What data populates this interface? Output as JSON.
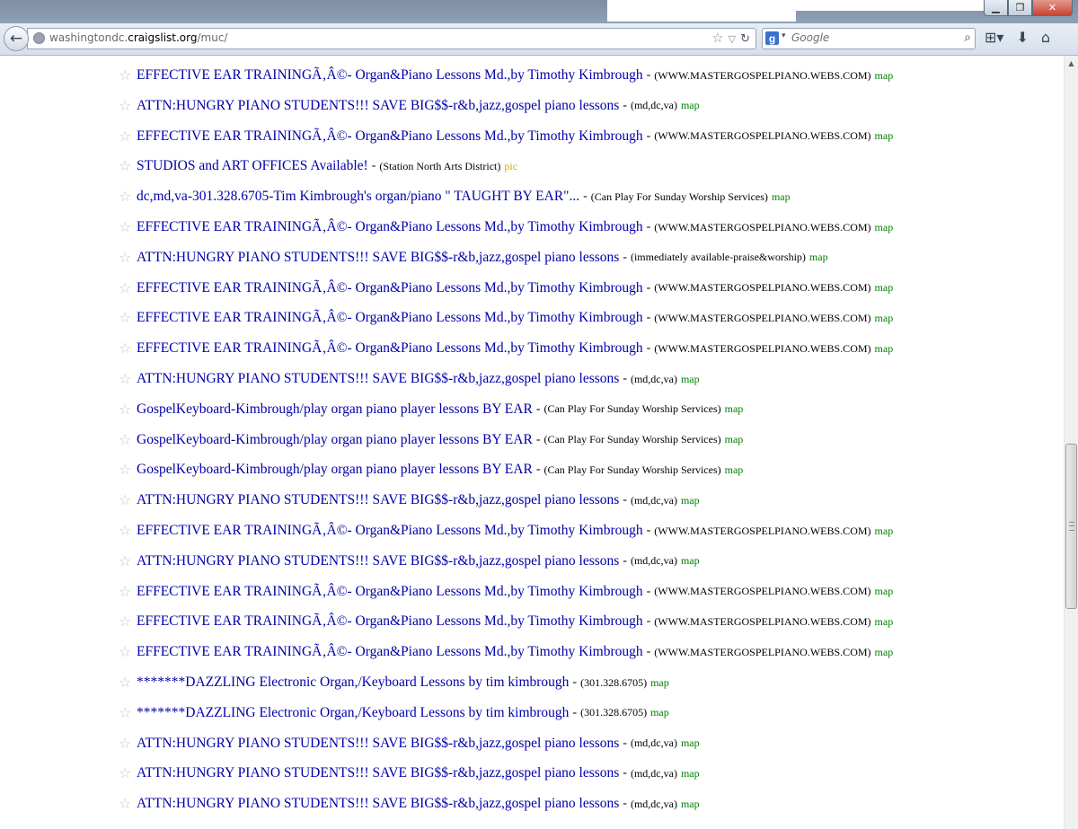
{
  "browser": {
    "url_prefix": "washingtondc.",
    "url_domain": "craigslist.org",
    "url_path": "/muc/",
    "search_placeholder": "Google",
    "search_engine_letter": "g"
  },
  "listings": [
    {
      "title": "EFFECTIVE EAR TRAININGÃ‚Â©- Organ&Piano Lessons Md.,by Timothy Kimbrough",
      "location": "(WWW.MASTERGOSPELPIANO.WEBS.COM)",
      "tag": "map"
    },
    {
      "title": "ATTN:HUNGRY PIANO STUDENTS!!! SAVE BIG$$-r&b,jazz,gospel piano lessons",
      "location": "(md,dc,va)",
      "tag": "map"
    },
    {
      "title": "EFFECTIVE EAR TRAININGÃ‚Â©- Organ&Piano Lessons Md.,by Timothy Kimbrough",
      "location": "(WWW.MASTERGOSPELPIANO.WEBS.COM)",
      "tag": "map"
    },
    {
      "title": "STUDIOS and ART OFFICES Available!",
      "location": "(Station North Arts District)",
      "tag": "pic"
    },
    {
      "title": "dc,md,va-301.328.6705-Tim Kimbrough's organ/piano \" TAUGHT BY EAR\"...",
      "location": "(Can Play For Sunday Worship Services)",
      "tag": "map"
    },
    {
      "title": "EFFECTIVE EAR TRAININGÃ‚Â©- Organ&Piano Lessons Md.,by Timothy Kimbrough",
      "location": "(WWW.MASTERGOSPELPIANO.WEBS.COM)",
      "tag": "map"
    },
    {
      "title": "ATTN:HUNGRY PIANO STUDENTS!!! SAVE BIG$$-r&b,jazz,gospel piano lessons",
      "location": "(immediately available-praise&worship)",
      "tag": "map"
    },
    {
      "title": "EFFECTIVE EAR TRAININGÃ‚Â©- Organ&Piano Lessons Md.,by Timothy Kimbrough",
      "location": "(WWW.MASTERGOSPELPIANO.WEBS.COM)",
      "tag": "map"
    },
    {
      "title": "EFFECTIVE EAR TRAININGÃ‚Â©- Organ&Piano Lessons Md.,by Timothy Kimbrough",
      "location": "(WWW.MASTERGOSPELPIANO.WEBS.COM)",
      "tag": "map"
    },
    {
      "title": "EFFECTIVE EAR TRAININGÃ‚Â©- Organ&Piano Lessons Md.,by Timothy Kimbrough",
      "location": "(WWW.MASTERGOSPELPIANO.WEBS.COM)",
      "tag": "map"
    },
    {
      "title": "ATTN:HUNGRY PIANO STUDENTS!!! SAVE BIG$$-r&b,jazz,gospel piano lessons",
      "location": "(md,dc,va)",
      "tag": "map"
    },
    {
      "title": "GospelKeyboard-Kimbrough/play organ piano player lessons BY EAR",
      "location": "(Can Play For Sunday Worship Services)",
      "tag": "map"
    },
    {
      "title": "GospelKeyboard-Kimbrough/play organ piano player lessons BY EAR",
      "location": "(Can Play For Sunday Worship Services)",
      "tag": "map"
    },
    {
      "title": "GospelKeyboard-Kimbrough/play organ piano player lessons BY EAR",
      "location": "(Can Play For Sunday Worship Services)",
      "tag": "map"
    },
    {
      "title": "ATTN:HUNGRY PIANO STUDENTS!!! SAVE BIG$$-r&b,jazz,gospel piano lessons",
      "location": "(md,dc,va)",
      "tag": "map"
    },
    {
      "title": "EFFECTIVE EAR TRAININGÃ‚Â©- Organ&Piano Lessons Md.,by Timothy Kimbrough",
      "location": "(WWW.MASTERGOSPELPIANO.WEBS.COM)",
      "tag": "map"
    },
    {
      "title": "ATTN:HUNGRY PIANO STUDENTS!!! SAVE BIG$$-r&b,jazz,gospel piano lessons",
      "location": "(md,dc,va)",
      "tag": "map"
    },
    {
      "title": "EFFECTIVE EAR TRAININGÃ‚Â©- Organ&Piano Lessons Md.,by Timothy Kimbrough",
      "location": "(WWW.MASTERGOSPELPIANO.WEBS.COM)",
      "tag": "map"
    },
    {
      "title": "EFFECTIVE EAR TRAININGÃ‚Â©- Organ&Piano Lessons Md.,by Timothy Kimbrough",
      "location": "(WWW.MASTERGOSPELPIANO.WEBS.COM)",
      "tag": "map"
    },
    {
      "title": "EFFECTIVE EAR TRAININGÃ‚Â©- Organ&Piano Lessons Md.,by Timothy Kimbrough",
      "location": "(WWW.MASTERGOSPELPIANO.WEBS.COM)",
      "tag": "map"
    },
    {
      "title": "*******DAZZLING Electronic Organ,/Keyboard Lessons by tim kimbrough",
      "location": "(301.328.6705)",
      "tag": "map"
    },
    {
      "title": "*******DAZZLING Electronic Organ,/Keyboard Lessons by tim kimbrough",
      "location": "(301.328.6705)",
      "tag": "map"
    },
    {
      "title": "ATTN:HUNGRY PIANO STUDENTS!!! SAVE BIG$$-r&b,jazz,gospel piano lessons",
      "location": "(md,dc,va)",
      "tag": "map"
    },
    {
      "title": "ATTN:HUNGRY PIANO STUDENTS!!! SAVE BIG$$-r&b,jazz,gospel piano lessons",
      "location": "(md,dc,va)",
      "tag": "map"
    },
    {
      "title": "ATTN:HUNGRY PIANO STUDENTS!!! SAVE BIG$$-r&b,jazz,gospel piano lessons",
      "location": "(md,dc,va)",
      "tag": "map"
    }
  ],
  "separator": "-",
  "colors": {
    "link": "#0000aa",
    "tag_map": "#008000",
    "tag_pic": "#e0a000",
    "star": "#c7c7c7"
  },
  "icons": {
    "back": "back-arrow-icon",
    "favicon": "globe-icon",
    "bookmark": "bookmark-star-icon",
    "history": "history-dropdown-icon",
    "reload": "reload-icon",
    "search": "magnifier-icon",
    "addon": "addon-icon",
    "download": "download-icon",
    "home": "home-icon",
    "listing_star": "star-outline-icon"
  }
}
